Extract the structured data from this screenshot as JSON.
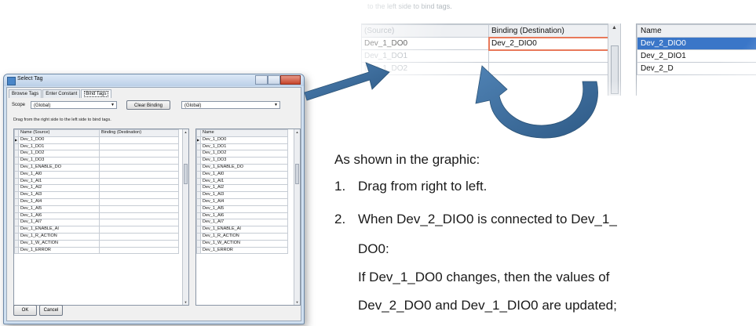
{
  "dialog": {
    "title": "Select Tag",
    "tabs": [
      "Browse Tags",
      "Enter Constant",
      "Bind Tags"
    ],
    "active_tab": "Bind Tags",
    "scope_label": "Scope",
    "scope_value": "(Global)",
    "clear_binding_label": "Clear Binding",
    "right_scope_value": "(Global)",
    "instruction": "Drag from the right side to the left side to bind tags.",
    "left_grid": {
      "headers": [
        "Name (Source)",
        "Binding (Destination)"
      ],
      "rows": [
        "Dev_1_DO0",
        "Dev_1_DO1",
        "Dev_1_DO2",
        "Dev_1_DO3",
        "Dev_1_ENABLE_DO",
        "Dev_1_AI0",
        "Dev_1_AI1",
        "Dev_1_AI2",
        "Dev_1_AI3",
        "Dev_1_AI4",
        "Dev_1_AI5",
        "Dev_1_AI6",
        "Dev_1_AI7",
        "Dev_1_ENABLE_AI",
        "Dev_1_R_ACTION",
        "Dev_1_W_ACTION",
        "Dev_1_ERROR"
      ]
    },
    "right_grid": {
      "header": "Name",
      "rows": [
        "Dev_1_DO0",
        "Dev_1_DO1",
        "Dev_1_DO2",
        "Dev_1_DO3",
        "Dev_1_ENABLE_DO",
        "Dev_1_AI0",
        "Dev_1_AI1",
        "Dev_1_AI2",
        "Dev_1_AI3",
        "Dev_1_AI4",
        "Dev_1_AI5",
        "Dev_1_AI6",
        "Dev_1_AI7",
        "Dev_1_ENABLE_AI",
        "Dev_1_R_ACTION",
        "Dev_1_W_ACTION",
        "Dev_1_ERROR"
      ]
    },
    "ok_label": "OK",
    "cancel_label": "Cancel"
  },
  "zoom": {
    "instruction": "to the left side to bind tags.",
    "left_headers": [
      "(Source)",
      "Binding (Destination)"
    ],
    "left_rows": [
      {
        "source": "Dev_1_DO0",
        "binding": "Dev_2_DIO0"
      },
      {
        "source": "Dev_1_DO1",
        "binding": ""
      },
      {
        "source": "Dev_1_DO2",
        "binding": ""
      }
    ],
    "right_header": "Name",
    "right_rows": [
      "Dev_2_DIO0",
      "Dev_2_DIO1",
      "Dev_2_D"
    ]
  },
  "explanation": {
    "lead": "As shown in the graphic:",
    "step1_num": "1.",
    "step1": "Drag from right to left.",
    "step2_num": "2.",
    "step2_line1": "When Dev_2_DIO0 is connected to Dev_1_",
    "step2_line2": "DO0:",
    "step2_line3": "If Dev_1_DO0 changes, then the values of",
    "step2_line4": "Dev_2_DO0 and Dev_1_DIO0 are updated;"
  },
  "colors": {
    "accent_arrow": "#3e6f9e",
    "highlight": "#e8795a",
    "selection": "#3a76c8"
  }
}
